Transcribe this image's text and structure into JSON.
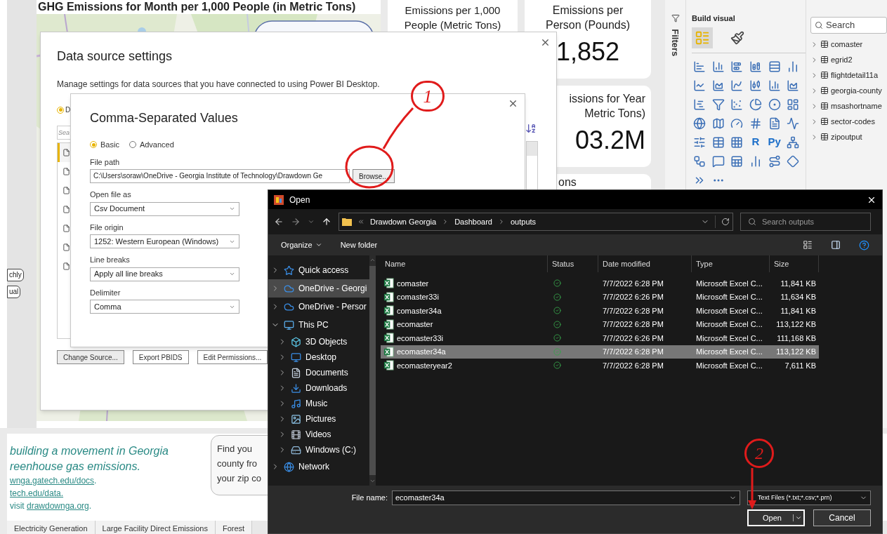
{
  "report": {
    "map_title": "GHG Emissions for Month per 1,000 People (in Metric Tons)",
    "side_pills": [
      "chly",
      "ual"
    ],
    "cards": [
      {
        "title": [
          "Emissions per 1,000",
          "People (Metric Tons)"
        ]
      },
      {
        "title": [
          "Emissions per",
          "Person (Pounds)"
        ],
        "value": "1,852"
      },
      {
        "title": [
          "issions for Year",
          "Metric Tons)"
        ],
        "value": "03.2M"
      },
      {
        "title": [
          "ons"
        ]
      }
    ],
    "footer_lines": [
      {
        "text": "building a movement in Georgia",
        "kind": "tagline"
      },
      {
        "text": "reenhouse gas emissions.",
        "kind": "tagline"
      },
      {
        "text": "wnga.gatech.edu/docs",
        "kind": "link",
        "after": "."
      },
      {
        "text": "tech.edu/data.",
        "kind": "link"
      },
      {
        "text": "visit ",
        "kind": "mixed",
        "link": "drawdownga.org",
        "after": "."
      }
    ],
    "zip_card": [
      "Find you",
      "county fro",
      "your zip co"
    ],
    "page_tabs": [
      "Electricity Generation",
      "Large Facility Direct Emissions",
      "Forest"
    ]
  },
  "filters_label": "Filters",
  "build_visual": {
    "title": "Build visual",
    "tabs": [
      {
        "selected": true
      },
      {
        "selected": false
      }
    ],
    "text_icons": [
      "R",
      "Py"
    ]
  },
  "fields": {
    "search_placeholder": "Search",
    "tables": [
      "comaster",
      "egrid2",
      "flightdetail11a",
      "georgia-county",
      "msashortname",
      "sector-codes",
      "zipoutput"
    ]
  },
  "data_source_settings": {
    "title": "Data source settings",
    "description": "Manage settings for data sources that you have connected to using Power BI Desktop.",
    "scope_radio": {
      "label": "D",
      "selected": true
    },
    "search_placeholder": "Sea",
    "rows": [
      {
        "selected": true
      },
      {
        "selected": false
      },
      {
        "selected": false
      },
      {
        "selected": false
      },
      {
        "selected": false
      },
      {
        "selected": false
      },
      {
        "selected": false
      }
    ],
    "buttons": [
      "Change Source...",
      "Export PBIDS",
      "Edit Permissions..."
    ]
  },
  "csv_dialog": {
    "title": "Comma-Separated Values",
    "modes": [
      {
        "label": "Basic",
        "selected": true
      },
      {
        "label": "Advanced",
        "selected": false
      }
    ],
    "file_path_label": "File path",
    "file_path": "C:\\Users\\soraw\\OneDrive - Georgia Institute of Technology\\Drawdown Ge",
    "browse": "Browse...",
    "selects": [
      {
        "label": "Open file as",
        "value": "Csv Document"
      },
      {
        "label": "File origin",
        "value": "1252: Western European (Windows)"
      },
      {
        "label": "Line breaks",
        "value": "Apply all line breaks"
      },
      {
        "label": "Delimiter",
        "value": "Comma"
      }
    ]
  },
  "open_dialog": {
    "title": "Open",
    "breadcrumb": [
      "Drawdown Georgia",
      "Dashboard",
      "outputs"
    ],
    "search_placeholder": "Search outputs",
    "toolbar": [
      "Organize",
      "New folder"
    ],
    "nav": [
      {
        "label": "Quick access",
        "kind": "star",
        "selected": false,
        "expanded": false
      },
      {
        "label": "OneDrive - Georgi",
        "kind": "cloud",
        "selected": true,
        "expanded": false
      },
      {
        "label": "OneDrive - Persor",
        "kind": "cloud",
        "selected": false,
        "expanded": false
      },
      {
        "label": "This PC",
        "kind": "pc",
        "selected": false,
        "expanded": true,
        "children": [
          {
            "label": "3D Objects",
            "kind": "cube"
          },
          {
            "label": "Desktop",
            "kind": "desktop"
          },
          {
            "label": "Documents",
            "kind": "documents"
          },
          {
            "label": "Downloads",
            "kind": "downloads"
          },
          {
            "label": "Music",
            "kind": "music"
          },
          {
            "label": "Pictures",
            "kind": "pictures"
          },
          {
            "label": "Videos",
            "kind": "videos"
          },
          {
            "label": "Windows (C:)",
            "kind": "drive"
          }
        ]
      },
      {
        "label": "Network",
        "kind": "network",
        "selected": false,
        "expanded": false
      }
    ],
    "columns": [
      "Name",
      "Status",
      "Date modified",
      "Type",
      "Size"
    ],
    "rows": [
      {
        "name": "comaster",
        "date": "7/7/2022 6:28 PM",
        "type": "Microsoft Excel C...",
        "size": "11,841 KB",
        "selected": false
      },
      {
        "name": "comaster33i",
        "date": "7/7/2022 6:26 PM",
        "type": "Microsoft Excel C...",
        "size": "11,634 KB",
        "selected": false
      },
      {
        "name": "comaster34a",
        "date": "7/7/2022 6:28 PM",
        "type": "Microsoft Excel C...",
        "size": "11,841 KB",
        "selected": false
      },
      {
        "name": "ecomaster",
        "date": "7/7/2022 6:28 PM",
        "type": "Microsoft Excel C...",
        "size": "113,122 KB",
        "selected": false
      },
      {
        "name": "ecomaster33i",
        "date": "7/7/2022 6:26 PM",
        "type": "Microsoft Excel C...",
        "size": "111,168 KB",
        "selected": false
      },
      {
        "name": "ecomaster34a",
        "date": "7/7/2022 6:28 PM",
        "type": "Microsoft Excel C...",
        "size": "113,122 KB",
        "selected": true
      },
      {
        "name": "ecomasteryear2",
        "date": "7/7/2022 6:28 PM",
        "type": "Microsoft Excel C...",
        "size": "7,611 KB",
        "selected": false
      }
    ],
    "file_name_label": "File name:",
    "file_name": "ecomaster34a",
    "file_type": "Text Files (*.txt;*.csv;*.prn)",
    "open": "Open",
    "cancel": "Cancel"
  },
  "annotations": [
    {
      "label": "1"
    },
    {
      "label": "2"
    }
  ]
}
